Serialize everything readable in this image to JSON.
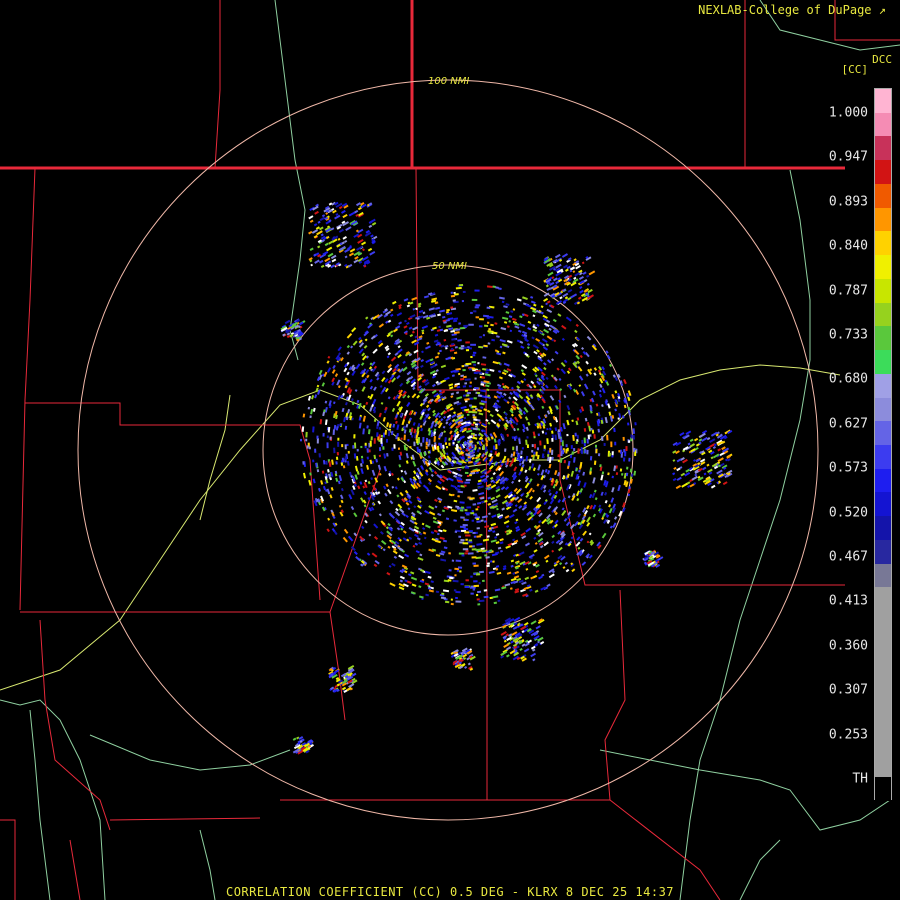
{
  "header": {
    "credit": "NEXLAB-College of DuPage",
    "site_label": "DCC",
    "product_code": "[CC]"
  },
  "rings": [
    {
      "label": "100 NMI",
      "range_nmi": 100
    },
    {
      "label": "50 NMI",
      "range_nmi": 50
    }
  ],
  "legend": {
    "ticks": [
      "1.000",
      "0.947",
      "0.893",
      "0.840",
      "0.787",
      "0.733",
      "0.680",
      "0.627",
      "0.573",
      "0.520",
      "0.467",
      "0.413",
      "0.360",
      "0.307",
      "0.253",
      "TH"
    ],
    "colors": [
      "#ffb4d2",
      "#f58cb4",
      "#c8325a",
      "#d21414",
      "#f05a00",
      "#ff9600",
      "#ffd200",
      "#f0f000",
      "#c8e600",
      "#96d21e",
      "#5ac83c",
      "#3cdc5a",
      "#a0a0e6",
      "#8c8cdc",
      "#6464e6",
      "#3c3cf0",
      "#1e1ef0",
      "#1414d2",
      "#1414aa",
      "#2828a0",
      "#787896",
      "#a0a0a0",
      "#a0a0a0",
      "#a0a0a0",
      "#a0a0a0",
      "#a0a0a0",
      "#a0a0a0",
      "#a0a0a0",
      "#a0a0a0",
      "#000000"
    ],
    "brand_color": "#e8e840",
    "border_color": "#e8293a",
    "road_color": "#d8e870",
    "river_color": "#8fd0a0",
    "ring_color": "#f0b8a8"
  },
  "footer": {
    "caption": "CORRELATION COEFFICIENT (CC) 0.5 DEG - KLRX 8 DEC 25 14:37"
  }
}
